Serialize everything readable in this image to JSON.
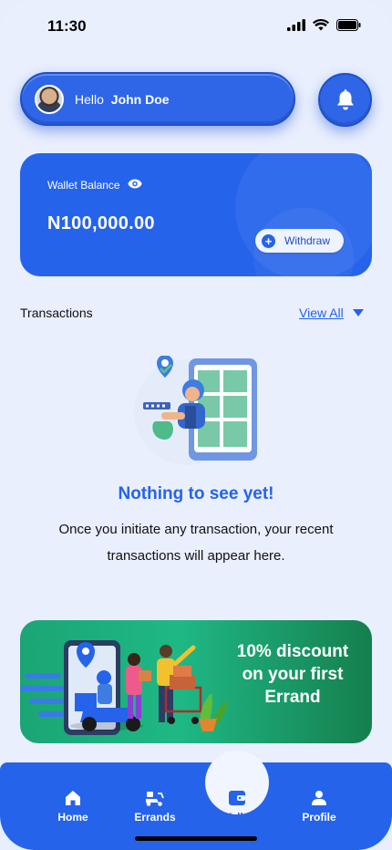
{
  "status_bar": {
    "time": "11:30"
  },
  "header": {
    "greeting": "Hello",
    "user_name": "John Doe"
  },
  "wallet": {
    "label": "Wallet Balance",
    "balance": "N100,000.00",
    "withdraw_label": "Withdraw"
  },
  "transactions": {
    "title": "Transactions",
    "view_all_label": "View All",
    "empty_title": "Nothing to see yet!",
    "empty_description": "Once you initiate any transaction, your recent transactions will appear here."
  },
  "promo": {
    "text": "10% discount on your first Errand"
  },
  "nav": {
    "items": [
      {
        "label": "Home",
        "icon": "home-icon"
      },
      {
        "label": "Errands",
        "icon": "delivery-icon"
      },
      {
        "label": "Wallet",
        "icon": "wallet-icon",
        "active": true
      },
      {
        "label": "Profile",
        "icon": "profile-icon"
      }
    ]
  },
  "colors": {
    "primary": "#2563eb",
    "background": "#e9effd",
    "promo_green": "#1fb885"
  }
}
